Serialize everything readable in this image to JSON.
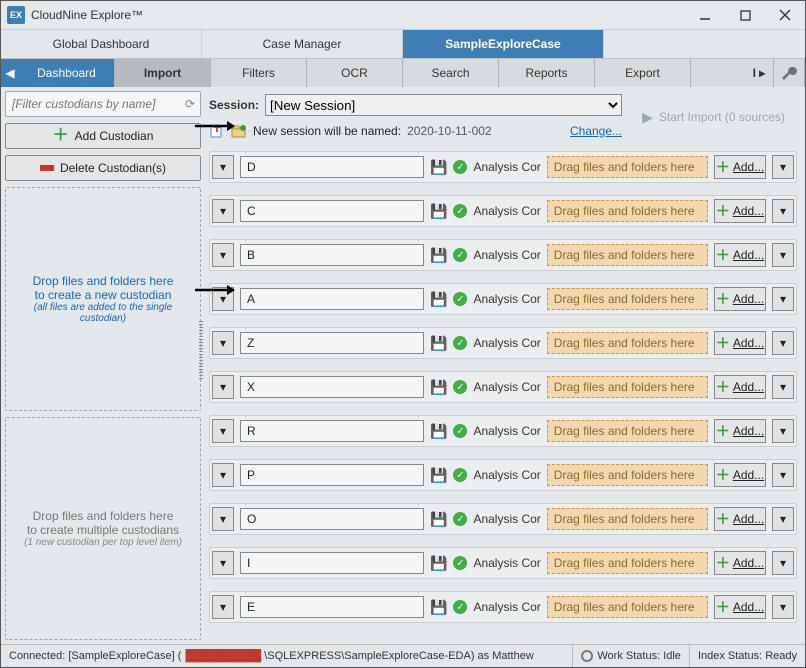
{
  "title": "CloudNine Explore™",
  "case_tabs": [
    "Global Dashboard",
    "Case Manager",
    "SampleExploreCase"
  ],
  "active_case": 2,
  "toolbar_left_scroll": "◀",
  "toolbar": [
    "Dashboard",
    "Import",
    "Filters",
    "OCR",
    "Search",
    "Reports",
    "Export"
  ],
  "toolbar_overflow": "I ▸",
  "active_tool": 1,
  "left": {
    "filter_placeholder": "[Filter custodians by name]",
    "add_label": "Add Custodian",
    "delete_label": "Delete Custodian(s)",
    "drop1_line1": "Drop files and folders here",
    "drop1_line2": "to create a new custodian",
    "drop1_sub": "(all files are added to the single custodian)",
    "drop2_line1": "Drop files and folders here",
    "drop2_line2": "to create multiple custodians",
    "drop2_sub": "(1 new custodian per top level item)"
  },
  "sessionbar": {
    "label": "Session:",
    "selected": "[New Session]",
    "start_label": "Start Import (0 sources)"
  },
  "newline": {
    "text": "New session will be named:",
    "value": "2020-10-11-002",
    "change": "Change..."
  },
  "row_drop_placeholder": "Drag files and folders here",
  "row_status": "Analysis Cor",
  "row_add_label": "Add...",
  "custodians": [
    "D",
    "C",
    "B",
    "A",
    "Z",
    "X",
    "R",
    "P",
    "O",
    "I",
    "E"
  ],
  "status": {
    "conn_prefix": "Connected: [SampleExploreCase] (",
    "conn_redacted": "███████████",
    "conn_suffix": "\\SQLEXPRESS\\SampleExploreCase-EDA) as Matthew",
    "work": "Work Status: Idle",
    "index": "Index Status: Ready"
  }
}
